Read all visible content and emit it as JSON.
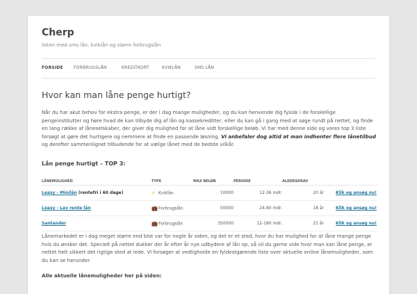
{
  "site": {
    "title": "Cherp",
    "description": "listen med sms lån, kviklån og større forbrugslån"
  },
  "nav": {
    "items": [
      {
        "label": "FORSIDE"
      },
      {
        "label": "FORBRUGSLÅN"
      },
      {
        "label": "KREDITKORT"
      },
      {
        "label": "KVIKLÅN"
      },
      {
        "label": "SMS LÅN"
      }
    ]
  },
  "main": {
    "heading": "Hvor kan man låne penge hurtigt?",
    "intro_text": "Når du har akut behov for ekstra penge, er der i dag mange muligheder, og du kan henvende dig fysisk i de forskellige pengeinstitutter og høre hvad de kan tilbyde dig af lån og kassekreditter, eller du kan gå i gang med at søge rundt på nettet, og finde en lang række af låneselskaber, der giver dig mulighed for at låne vidt forskellige beløb. Vi har med denne side og vores top 3 liste forsøgt at gøre det hurtigere og nemmere at finde en passende løsning.",
    "intro_emphasis": "Vi anbefaler dog altid at man indhenter flere lånetilbud",
    "intro_tail": "og derefter sammenlignet tilbudende for at vælge lånet med de bedste vilkår.",
    "top3_heading": "Lån penge hurtigt – TOP 3:",
    "table": {
      "headers": [
        "LÅNEMULIGHED",
        "TYPE",
        "MAX BELØB",
        "PERIODE",
        "ALDERSKRAV",
        ""
      ],
      "rows": [
        {
          "name": "Leasy - Minilån",
          "note": "(rentefri i 60 dage)",
          "type_icon": "lightning-icon",
          "type": "Kviklån",
          "max": "10000",
          "period": "12-36 mdr.",
          "age": "20 år",
          "cta": "Klik og ansøg nu!"
        },
        {
          "name": "Leasy - Lav rente lån",
          "note": "",
          "type_icon": "briefcase-icon",
          "type": "Forbrugslån",
          "max": "50000",
          "period": "24-60 mdr.",
          "age": "18 år",
          "cta": "Klik og ansøg nu!"
        },
        {
          "name": "Santander",
          "note": "",
          "type_icon": "briefcase-icon",
          "type": "Forbrugslån",
          "max": "350000",
          "period": "12-180 mdr.",
          "age": "21 år",
          "cta": "Klik og ansøg nu!"
        }
      ]
    },
    "paragraph2": "Lånemarkedet er i dag meget større end blot var for nogle år siden, og det er et sted, hvor du har mulighed for at låne mange penge hvis du ønsker det. Specielt på nettet dukker der år efter år nye udbydere af lån op, så vil du gerne vide hvor man kan låne penge, er nettet helt sikkert det rigtige sted at lede. Vi forsøger at vedligholde en fyldestgørende liste over aktuelle online lånemuligheder, som du kan se herunder.",
    "list_heading": "Alle aktuelle lånemuligheder her på siden:"
  },
  "colors": {
    "background": "#e6e6e6",
    "page": "#ffffff",
    "link": "#21759b",
    "text": "#444444"
  }
}
